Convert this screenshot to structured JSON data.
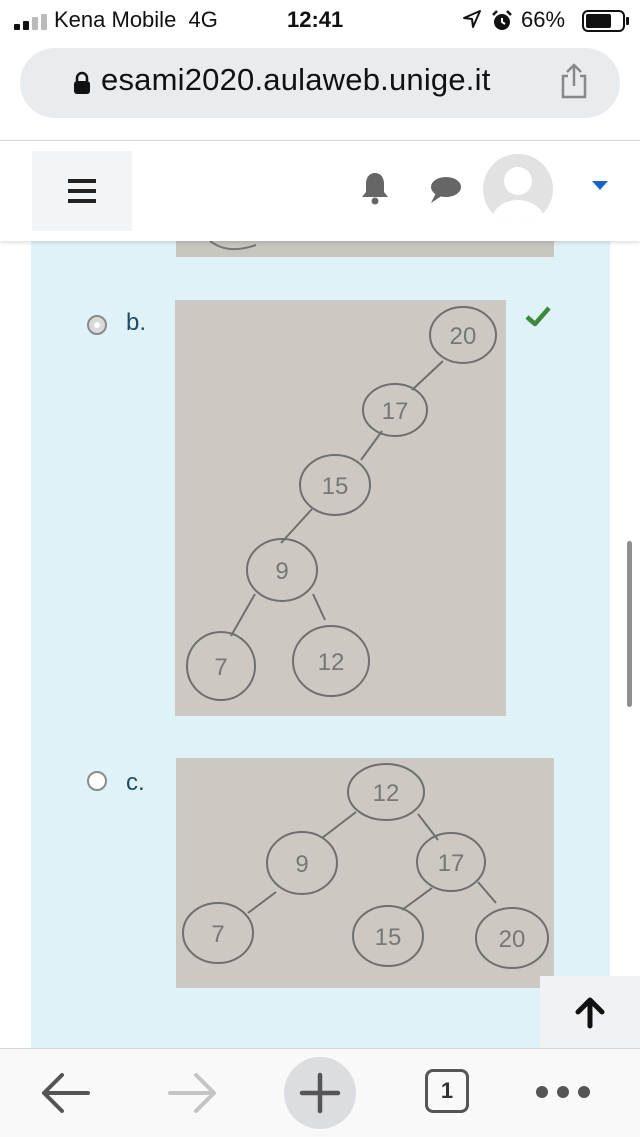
{
  "status_bar": {
    "carrier": "Kena Mobile",
    "network": "4G",
    "time": "12:41",
    "battery": "66%",
    "icons": [
      "signal-icon",
      "location-icon",
      "alarm-icon",
      "battery-icon"
    ]
  },
  "address_bar": {
    "url": "esami2020.aulaweb.unige.it",
    "icons": [
      "lock-icon",
      "share-icon"
    ]
  },
  "site_header": {
    "icons": [
      "menu-icon",
      "bell-icon",
      "chat-icon",
      "avatar",
      "caret-down-icon"
    ]
  },
  "question": {
    "options": [
      {
        "letter": "b.",
        "selected": true,
        "correct": true,
        "tree_nodes": [
          "20",
          "17",
          "15",
          "9",
          "7",
          "12"
        ]
      },
      {
        "letter": "c.",
        "selected": false,
        "correct": false,
        "tree_nodes": [
          "12",
          "9",
          "17",
          "7",
          "15",
          "20"
        ]
      }
    ]
  },
  "scroll_top_button": {
    "icon": "arrow-up-icon"
  },
  "toolbar": {
    "tab_count": "1",
    "icons": [
      "back-arrow-icon",
      "forward-arrow-icon",
      "plus-icon",
      "tabs-icon",
      "more-icon"
    ]
  },
  "colors": {
    "panel_background": "#def2f8",
    "option_label": "#1f4b63",
    "correct_check": "#3a8a3a",
    "caret": "#1a66c8"
  }
}
